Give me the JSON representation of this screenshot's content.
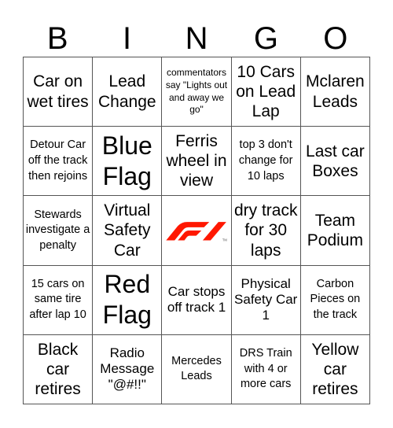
{
  "header": {
    "letters": [
      "B",
      "I",
      "N",
      "G",
      "O"
    ]
  },
  "free_space": {
    "icon": "f1-logo-icon",
    "color": "#ff1801"
  },
  "cells": [
    {
      "text": "Car on wet tires",
      "size": "l"
    },
    {
      "text": "Lead Change",
      "size": "l"
    },
    {
      "text": "commentators say \"Lights out and away we go\"",
      "size": "xs"
    },
    {
      "text": "10 Cars on Lead Lap",
      "size": "l"
    },
    {
      "text": "Mclaren Leads",
      "size": "l"
    },
    {
      "text": "Detour Car off the track then rejoins",
      "size": "s"
    },
    {
      "text": "Blue Flag",
      "size": "xl"
    },
    {
      "text": "Ferris wheel in view",
      "size": "l"
    },
    {
      "text": "top 3 don't change for 10 laps",
      "size": "s"
    },
    {
      "text": "Last car Boxes",
      "size": "l"
    },
    {
      "text": "Stewards investigate a penalty",
      "size": "s"
    },
    {
      "text": "Virtual Safety Car",
      "size": "l"
    },
    {
      "text": "",
      "size": "free"
    },
    {
      "text": "dry track for 30 laps",
      "size": "l"
    },
    {
      "text": "Team Podium",
      "size": "l"
    },
    {
      "text": "15 cars on same tire after lap 10",
      "size": "s"
    },
    {
      "text": "Red Flag",
      "size": "xl"
    },
    {
      "text": "Car stops off track 1",
      "size": "m"
    },
    {
      "text": "Physical Safety Car 1",
      "size": "m"
    },
    {
      "text": "Carbon Pieces on the track",
      "size": "s"
    },
    {
      "text": "Black car retires",
      "size": "l"
    },
    {
      "text": "Radio Message \"@#!!\"",
      "size": "m"
    },
    {
      "text": "Mercedes Leads",
      "size": "s"
    },
    {
      "text": "DRS Train with 4 or more cars",
      "size": "s"
    },
    {
      "text": "Yellow car retires",
      "size": "l"
    }
  ]
}
